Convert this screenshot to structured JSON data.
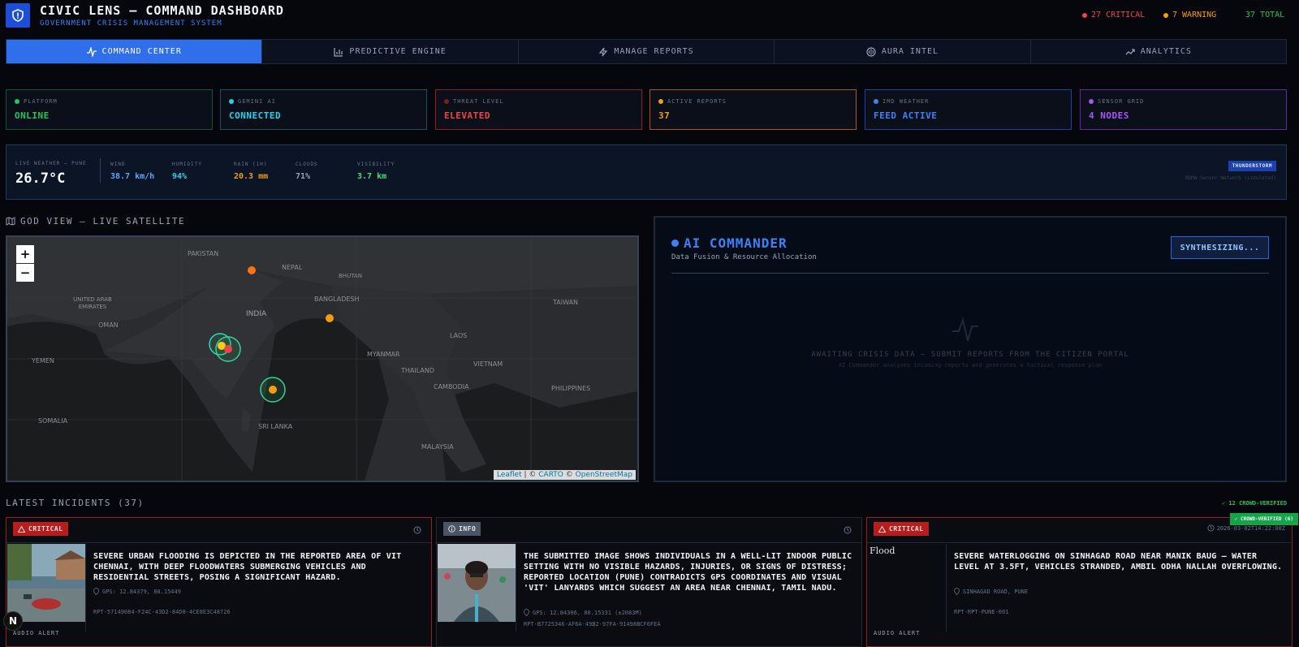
{
  "header": {
    "title": "CIVIC LENS — COMMAND DASHBOARD",
    "subtitle": "GOVERNMENT CRISIS MANAGEMENT SYSTEM",
    "stats": {
      "critical": "27 CRITICAL",
      "warning": "7 WARNING",
      "total": "37 TOTAL"
    },
    "colors": {
      "critical": "#ef4444",
      "warning": "#f59e0b",
      "total": "#22c55e"
    }
  },
  "nav": {
    "tabs": [
      {
        "label": "COMMAND CENTER",
        "icon": "pulse-icon"
      },
      {
        "label": "PREDICTIVE ENGINE",
        "icon": "bar-chart-icon"
      },
      {
        "label": "MANAGE REPORTS",
        "icon": "bolt-icon"
      },
      {
        "label": "AURA INTEL",
        "icon": "brain-icon"
      },
      {
        "label": "ANALYTICS",
        "icon": "trend-up-icon"
      }
    ],
    "active": "COMMAND CENTER"
  },
  "status_cards": [
    {
      "label": "PLATFORM",
      "value": "ONLINE",
      "color": "#22c55e"
    },
    {
      "label": "GEMINI AI",
      "value": "CONNECTED",
      "color": "#22d3ee"
    },
    {
      "label": "THREAT LEVEL",
      "value": "ELEVATED",
      "color": "#ef4444"
    },
    {
      "label": "ACTIVE REPORTS",
      "value": "37",
      "color": "#f59e0b"
    },
    {
      "label": "IMD WEATHER",
      "value": "FEED ACTIVE",
      "color": "#3b82f6"
    },
    {
      "label": "SENSOR GRID",
      "value": "4 NODES",
      "color": "#a855f7"
    }
  ],
  "weather": {
    "location_label": "LIVE WEATHER — PUNE",
    "temperature": "26.7°C",
    "metrics": [
      {
        "label": "WIND",
        "value": "38.7 km/h",
        "color": "#60a5fa"
      },
      {
        "label": "HUMIDITY",
        "value": "94%",
        "color": "#22d3ee"
      },
      {
        "label": "RAIN (1H)",
        "value": "20.3 mm",
        "color": "#f59e0b"
      },
      {
        "label": "CLOUDS",
        "value": "71%",
        "color": "#94a3b8"
      },
      {
        "label": "VISIBILITY",
        "value": "3.7 km",
        "color": "#4ade80"
      }
    ],
    "condition_badge": "THUNDERSTORM",
    "source": "NDMA Sensor Network (simulated)"
  },
  "map_section": {
    "title": "GOD VIEW — LIVE SATELLITE",
    "zoom_in": "+",
    "zoom_out": "−",
    "labels": [
      "PAKISTAN",
      "NEPAL",
      "BHUTAN",
      "INDIA",
      "BANGLADESH",
      "TAIWAN",
      "UNITED ARAB EMIRATES",
      "OMAN",
      "YEMEN",
      "MYANMAR",
      "LAOS",
      "THAILAND",
      "VIETNAM",
      "CAMBODIA",
      "PHILIPPINES",
      "SRI LANKA",
      "SOMALIA",
      "MALAYSIA"
    ],
    "attribution": {
      "leaflet": "Leaflet",
      "sep": " | © ",
      "carto": "CARTO",
      "osm_prefix": " © ",
      "osm": "OpenStreetMap"
    }
  },
  "ai_commander": {
    "title": "AI COMMANDER",
    "subtitle": "Data Fusion & Resource Allocation",
    "button": "SYNTHESIZING...",
    "empty_title": "AWAITING CRISIS DATA — SUBMIT REPORTS FROM THE CITIZEN PORTAL",
    "empty_sub": "AI Commander analyzes incoming reports and generates a tactical response plan"
  },
  "incidents": {
    "title": "LATEST INCIDENTS (37)",
    "crowd_count": "✓ 12 CROWD-VERIFIED",
    "items": [
      {
        "severity": "CRITICAL",
        "color": "#dc2626",
        "timestamp": "",
        "description": "SEVERE URBAN FLOODING IS DEPICTED IN THE REPORTED AREA OF VIT CHENNAI, WITH DEEP FLOODWATERS SUBMERGING VEHICLES AND RESIDENTIAL STREETS, POSING A SIGNIFICANT HAZARD.",
        "location": "GPS: 12.84379, 80.15449",
        "report_id": "RPT-57149084-F24C-43D2-84D8-4CE8E3C48726",
        "audio": "AUDIO ALERT"
      },
      {
        "severity": "INFO",
        "color": "#6b7280",
        "timestamp": "",
        "description": "THE SUBMITTED IMAGE SHOWS INDIVIDUALS IN A WELL-LIT INDOOR PUBLIC SETTING WITH NO VISIBLE HAZARDS, INJURIES, OR SIGNS OF DISTRESS; REPORTED LOCATION (PUNE) CONTRADICTS GPS COORDINATES AND VISUAL 'VIT' LANYARDS WHICH SUGGEST AN AREA NEAR CHENNAI, TAMIL NADU.",
        "location": "GPS: 12.84306, 80.15331 (±2083M)",
        "report_id": "RPT-B7725346-AF6A-49B2-97FA-91498BCF6FEA",
        "audio": ""
      },
      {
        "severity": "CRITICAL",
        "color": "#dc2626",
        "timestamp": "2026-03-02T14:22:00Z",
        "crowd_badge": "✓ CROWD-VERIFIED (6)",
        "image_alt": "Flood",
        "description": "SEVERE WATERLOGGING ON SINHAGAD ROAD NEAR MANIK BAUG — WATER LEVEL AT 3.5FT, VEHICLES STRANDED, AMBIL ODHA NALLAH OVERFLOWING.",
        "location": "SINHAGAD ROAD, PUNE",
        "report_id": "RPT-RPT-PUNE-001",
        "audio": "AUDIO ALERT"
      }
    ]
  }
}
